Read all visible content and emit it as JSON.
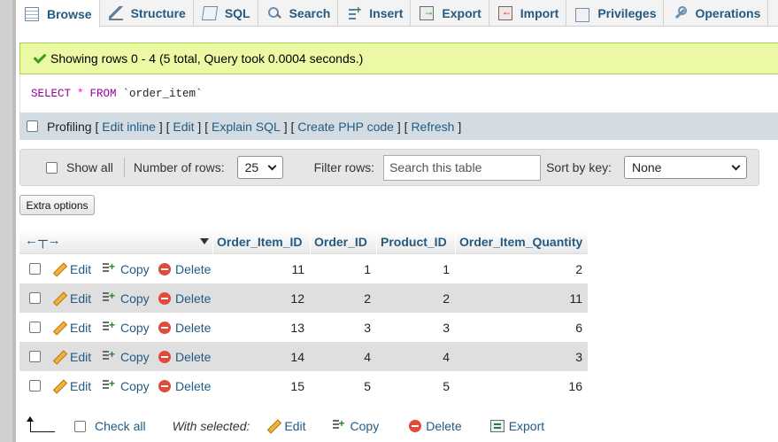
{
  "tabs": [
    {
      "label": "Browse",
      "icon": "browse-icon",
      "active": true
    },
    {
      "label": "Structure",
      "icon": "structure-icon"
    },
    {
      "label": "SQL",
      "icon": "sql-icon"
    },
    {
      "label": "Search",
      "icon": "search-icon"
    },
    {
      "label": "Insert",
      "icon": "insert-icon"
    },
    {
      "label": "Export",
      "icon": "export-icon"
    },
    {
      "label": "Import",
      "icon": "import-icon"
    },
    {
      "label": "Privileges",
      "icon": "privileges-icon"
    },
    {
      "label": "Operations",
      "icon": "operations-icon"
    }
  ],
  "success": {
    "message": "Showing rows 0 - 4 (5 total, Query took 0.0004 seconds.)"
  },
  "sql": {
    "select": "SELECT",
    "star": "*",
    "from": "FROM",
    "table": "`order_item`"
  },
  "profiling": {
    "label": "Profiling",
    "links": [
      "Edit inline",
      "Edit",
      "Explain SQL",
      "Create PHP code",
      "Refresh"
    ]
  },
  "nav": {
    "show_all": "Show all",
    "num_rows_label": "Number of rows:",
    "num_rows_value": "25",
    "filter_label": "Filter rows:",
    "filter_placeholder": "Search this table",
    "sort_label": "Sort by key:",
    "sort_value": "None"
  },
  "extra_options": "Extra options",
  "table": {
    "columns": [
      "Order_Item_ID",
      "Order_ID",
      "Product_ID",
      "Order_Item_Quantity"
    ],
    "actions": {
      "edit": "Edit",
      "copy": "Copy",
      "delete": "Delete"
    },
    "rows": [
      [
        "11",
        "1",
        "1",
        "2"
      ],
      [
        "12",
        "2",
        "2",
        "11"
      ],
      [
        "13",
        "3",
        "3",
        "6"
      ],
      [
        "14",
        "4",
        "4",
        "3"
      ],
      [
        "15",
        "5",
        "5",
        "16"
      ]
    ]
  },
  "bottom": {
    "check_all": "Check all",
    "with_selected": "With selected:",
    "edit": "Edit",
    "copy": "Copy",
    "delete": "Delete",
    "export": "Export"
  },
  "colors": {
    "link": "#235a81",
    "success_bg": "#ebf8a4",
    "profbar_bg": "#d3dce3"
  }
}
